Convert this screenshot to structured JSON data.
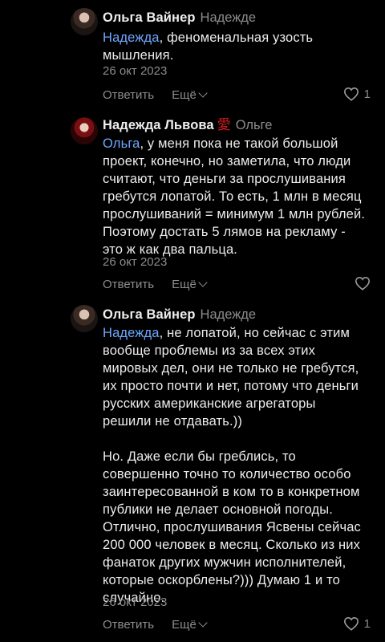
{
  "comments": [
    {
      "author": "Ольга Вайнер",
      "reply_to": "Надежде",
      "mention": "Надежда",
      "text_lines": [
        ", феноменальная узость",
        "мышления."
      ],
      "date": "26 окт 2023",
      "reply_label": "Ответить",
      "more_label": "Ещё",
      "likes": "1"
    },
    {
      "author": "Надежда Львова",
      "badge": "愛",
      "reply_to": "Ольге",
      "mention": "Ольга",
      "text_lines": [
        ", у меня пока не такой большой",
        "проект, конечно, но заметила, что люди",
        "считают, что деньги за прослушивания",
        "гребутся лопатой. То есть, 1 млн в месяц",
        "прослушиваний = минимум 1 млн рублей.",
        "Поэтому достать 5 лямов на рекламу -",
        "это ж как два пальца."
      ],
      "date": "26 окт 2023",
      "reply_label": "Ответить",
      "more_label": "Ещё"
    },
    {
      "author": "Ольга Вайнер",
      "reply_to": "Надежде",
      "mention": "Надежда",
      "text_lines": [
        ", не лопатой, но сейчас с этим",
        "вообще проблемы из за всех этих",
        "мировых дел, они не только не гребутся,",
        "их просто почти и нет, потому что деньги",
        "русских американские агрегаторы",
        "решили не отдавать.))"
      ],
      "text_lines_2": [
        "Но. Даже если бы греблись, то",
        "совершенно точно то количество особо",
        "заинтересованной в ком то в конкретном",
        "публики не делает основной погоды.",
        "Отлично, прослушивания Ясвены сейчас",
        "200 000 человек в месяц. Сколько из них",
        "фанаток других мужчин исполнителей,",
        "которые оскорблены?))) Думаю 1 и то",
        "случайно."
      ],
      "date": "26 окт 2023",
      "reply_label": "Ответить",
      "more_label": "Ещё",
      "likes": "1"
    }
  ]
}
